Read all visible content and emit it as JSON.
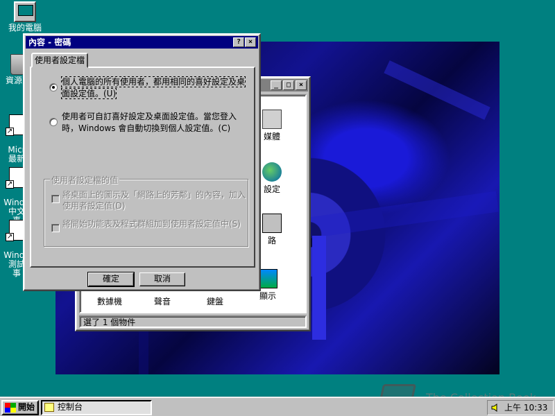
{
  "desktop": {
    "icons": [
      {
        "label": "我的電腦",
        "icon": "my-computer-icon"
      },
      {
        "label": "資源回",
        "icon": "recycle-bin-icon"
      },
      {
        "label": "Micr\n最新",
        "icon": "shortcut-icon"
      },
      {
        "label": "Windo\n中文\n事",
        "icon": "shortcut-icon"
      },
      {
        "label": "Windo\n測試\n事",
        "icon": "shortcut-icon"
      }
    ]
  },
  "control_panel": {
    "items": [
      {
        "label": "媒體",
        "icon": "multimedia-icon"
      },
      {
        "label": "設定",
        "icon": "regional-settings-icon"
      },
      {
        "label": "路",
        "icon": "network-icon"
      },
      {
        "label": "數據機",
        "icon": "modem-icon"
      },
      {
        "label": "聲音",
        "icon": "sounds-icon"
      },
      {
        "label": "鍵盤",
        "icon": "keyboard-icon"
      },
      {
        "label": "顯示",
        "icon": "display-icon"
      }
    ],
    "status": "選了 1 個物件",
    "buttons": {
      "minimize": "_",
      "maximize": "□",
      "close": "×"
    }
  },
  "dialog": {
    "title": "內容 - 密碼",
    "help": "?",
    "close": "×",
    "tab": "使用者設定檔",
    "option1": "個人電腦的所有使用者，都用相同的喜好設定及桌面設定值。(U)",
    "option2": "使用者可自訂喜好設定及桌面設定值。當您登入時，Windows 會自動切換到個人設定值。(C)",
    "group_title": "使用者設定檔的值",
    "check1": "將桌面上的圖示及「網路上的芳鄰」的內容，加入使用者設定值(D)",
    "check2": "將開始功能表及程式群組加到使用者設定值中(S)",
    "ok": "確定",
    "cancel": "取消"
  },
  "taskbar": {
    "start": "開始",
    "task": "控制台",
    "clock": "上午 10:33"
  },
  "watermark": "The Collection Book",
  "colors": {
    "desktop": "#008080",
    "titlebar_active": "#000080",
    "titlebar_inactive": "#808080",
    "face": "#c0c0c0"
  }
}
